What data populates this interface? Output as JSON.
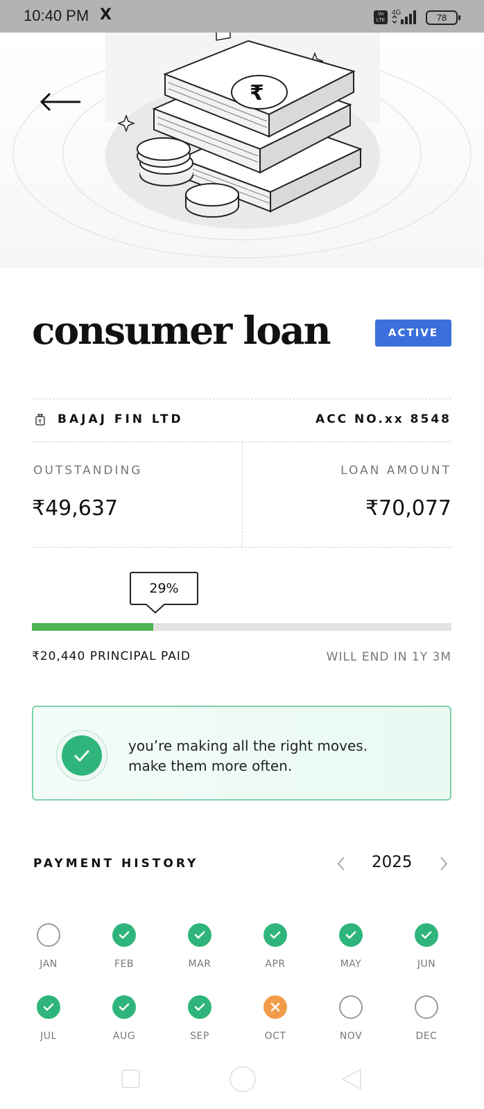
{
  "status_bar": {
    "time": "10:40 PM",
    "app_icon": "X",
    "volte_top": "Vo",
    "volte_bottom": "LTE",
    "network": "4G",
    "battery": "78"
  },
  "loan": {
    "title": "consumer loan",
    "status": "ACTIVE",
    "status_color": "#3b6fdc",
    "lender": "BAJAJ FIN LTD",
    "account_number": "ACC NO.xx 8548",
    "outstanding_label": "OUTSTANDING",
    "outstanding_value": "₹49,637",
    "loan_amount_label": "LOAN AMOUNT",
    "loan_amount_value": "₹70,077"
  },
  "progress": {
    "percent_label": "29%",
    "fraction": 0.29,
    "fill_color": "#4cb252",
    "principal_paid": "₹20,440 PRINCIPAL PAID",
    "end_info": "WILL END IN 1Y 3M"
  },
  "message": {
    "line1": "you’re making all the right moves.",
    "line2": "make them more often."
  },
  "payment_history": {
    "title": "PAYMENT HISTORY",
    "year": "2025",
    "months": [
      {
        "label": "JAN",
        "status": "upcoming"
      },
      {
        "label": "FEB",
        "status": "paid"
      },
      {
        "label": "MAR",
        "status": "paid"
      },
      {
        "label": "APR",
        "status": "paid"
      },
      {
        "label": "MAY",
        "status": "paid"
      },
      {
        "label": "JUN",
        "status": "paid"
      },
      {
        "label": "JUL",
        "status": "paid"
      },
      {
        "label": "AUG",
        "status": "paid"
      },
      {
        "label": "SEP",
        "status": "paid"
      },
      {
        "label": "OCT",
        "status": "missed"
      },
      {
        "label": "NOV",
        "status": "upcoming"
      },
      {
        "label": "DEC",
        "status": "upcoming"
      }
    ]
  },
  "icons": {
    "back": "arrow-left-icon",
    "lender": "money-bag-icon",
    "prev_year": "chevron-left-icon",
    "next_year": "chevron-right-icon",
    "success": "check-icon"
  }
}
